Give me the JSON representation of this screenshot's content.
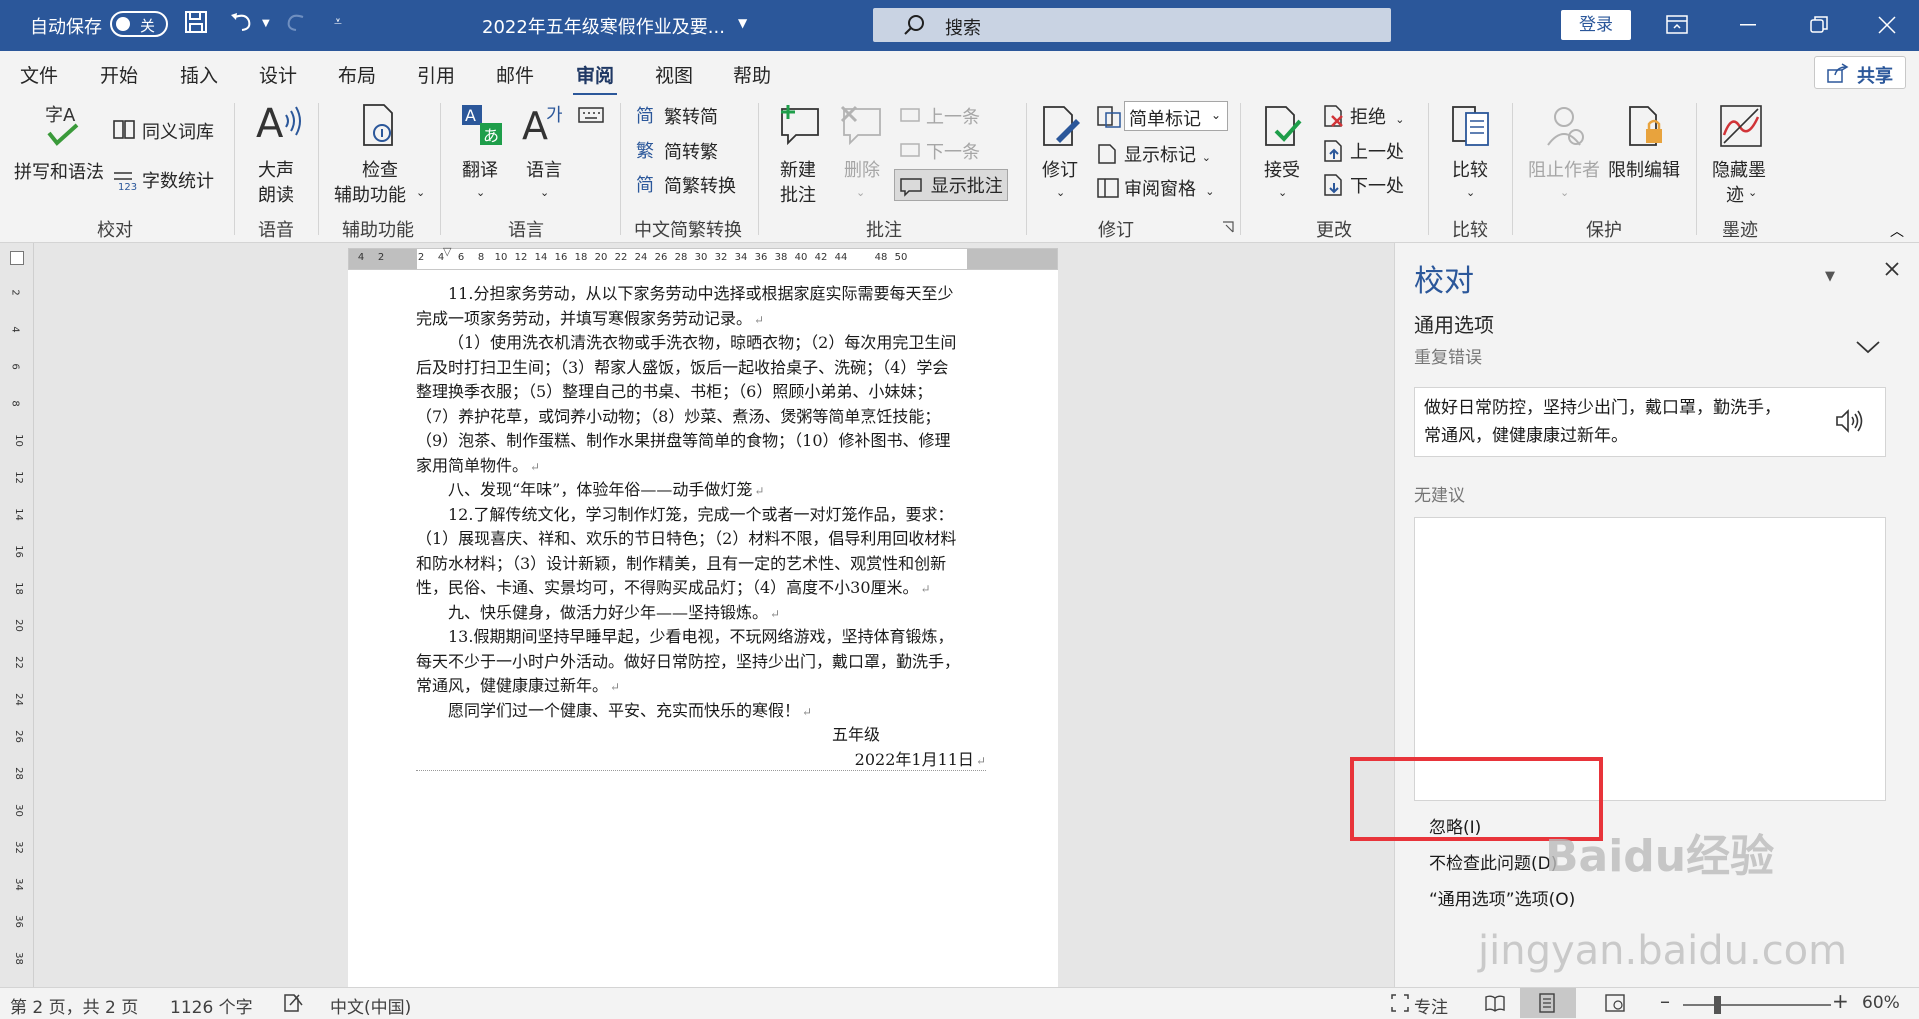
{
  "titlebar": {
    "autosave": "自动保存",
    "toggle": "关",
    "doc_title": "2022年五年级寒假作业及要...",
    "search": "搜索",
    "login": "登录"
  },
  "tabs": [
    "文件",
    "开始",
    "插入",
    "设计",
    "布局",
    "引用",
    "邮件",
    "审阅",
    "视图",
    "帮助"
  ],
  "active_tab": "审阅",
  "share": "共享",
  "ribbon": {
    "spelling": "拼写和语法",
    "thesaurus": "同义词库",
    "wordcount": "字数统计",
    "g_proof": "校对",
    "read_aloud_1": "大声",
    "read_aloud_2": "朗读",
    "g_speech": "语音",
    "check_access_1": "检查",
    "check_access_2": "辅助功能",
    "g_access": "辅助功能",
    "translate": "翻译",
    "language": "语言",
    "g_language": "语言",
    "t2s": "繁转简",
    "s2t": "简转繁",
    "sconv": "简繁转换",
    "g_chinese": "中文简繁转换",
    "new_comment_1": "新建",
    "new_comment_2": "批注",
    "delete": "删除",
    "prev": "上一条",
    "next": "下一条",
    "show_comments": "显示批注",
    "g_comments": "批注",
    "track_1": "修订",
    "markup_select": "简单标记",
    "show_markup": "显示标记",
    "review_pane": "审阅窗格",
    "g_tracking": "修订",
    "accept": "接受",
    "reject": "拒绝",
    "prev_change": "上一处",
    "next_change": "下一处",
    "g_changes": "更改",
    "compare": "比较",
    "g_compare": "比较",
    "block_authors": "阻止作者",
    "restrict": "限制编辑",
    "g_protect": "保护",
    "hide_ink_1": "隐藏墨",
    "hide_ink_2": "迹",
    "g_ink": "墨迹"
  },
  "ruler": {
    "h": [
      "4",
      "2",
      "2",
      "4",
      "6",
      "8",
      "10",
      "12",
      "14",
      "16",
      "18",
      "20",
      "22",
      "24",
      "26",
      "28",
      "30",
      "32",
      "34",
      "36",
      "38",
      "40",
      "42",
      "44",
      "48",
      "50"
    ],
    "v": [
      "2",
      "4",
      "6",
      "8",
      "10",
      "12",
      "14",
      "16",
      "18",
      "20",
      "22",
      "24",
      "26",
      "28",
      "30",
      "32",
      "34",
      "36",
      "38"
    ]
  },
  "document": {
    "lines": [
      "11.分担家务劳动，从以下家务劳动中选择或根据家庭实际需要每天至少",
      "完成一项家务劳动，并填写寒假家务劳动记录。",
      "（1）使用洗衣机清洗衣物或手洗衣物，晾晒衣物；（2）每次用完卫生间",
      "后及时打扫卫生间；（3）帮家人盛饭，饭后一起收拾桌子、洗碗；（4）学会",
      "整理换季衣服；（5）整理自己的书桌、书柜；（6）照顾小弟弟、小妹妹；",
      "（7）养护花草，或饲养小动物；（8）炒菜、煮汤、煲粥等简单烹饪技能；",
      "（9）泡茶、制作蛋糕、制作水果拼盘等简单的食物；（10）修补图书、修理",
      "家用简单物件。",
      "八、发现“年味”，体验年俗——动手做灯笼",
      "12.了解传统文化，学习制作灯笼，完成一个或者一对灯笼作品，要求：",
      "（1）展现喜庆、祥和、欢乐的节日特色；（2）材料不限，倡导利用回收材料",
      "和防水材料；（3）设计新颖，制作精美，且有一定的艺术性、观赏性和创新",
      "性，民俗、卡通、实景均可，不得购买成品灯；（4）高度不小30厘米。",
      "九、快乐健身，做活力好少年——坚持锻炼。",
      "13.假期期间坚持早睡早起，少看电视，不玩网络游戏，坚持体育锻炼，",
      "每天不少于一小时户外活动。做好日常防控，坚持少出门，戴口罩，勤洗手，",
      "常通风，健健康康过新年。",
      "愿同学们过一个健康、平安、充实而快乐的寒假！",
      "五年级",
      "2022年1月11日"
    ]
  },
  "pane": {
    "title": "校对",
    "section": "通用选项",
    "issue": "重复错误",
    "sentence_1": "做好日常防控，坚持少出门，戴口罩，勤洗手，",
    "sentence_2": "常通风，健健康康过新年。",
    "no_suggestions": "无建议",
    "ignore": "忽略(I)",
    "dont_check": "不检查此问题(D)",
    "options": "“通用选项”选项(O)"
  },
  "status": {
    "page": "第 2 页，共 2 页",
    "words": "1126 个字",
    "lang": "中文(中国)",
    "focus": "专注",
    "zoom": "60%"
  },
  "watermark": {
    "logo": "Baidu经验",
    "url": "jingyan.baidu.com"
  }
}
